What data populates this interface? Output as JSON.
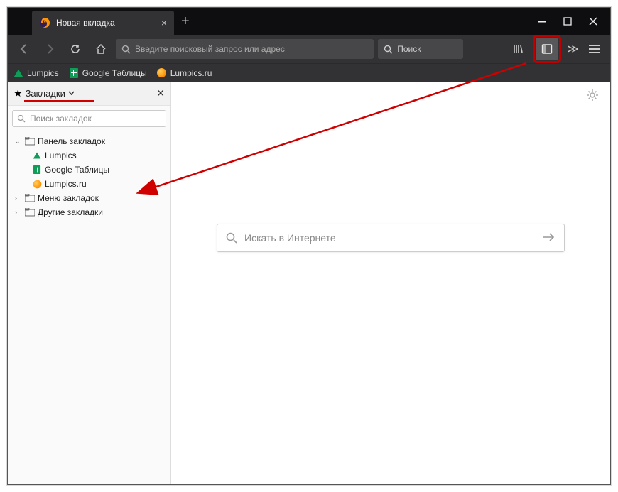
{
  "tab": {
    "title": "Новая вкладка"
  },
  "urlbar": {
    "placeholder": "Введите поисковый запрос или адрес"
  },
  "searchbar": {
    "placeholder": "Поиск"
  },
  "bookmarks_toolbar": [
    {
      "label": "Lumpics",
      "icon": "drive"
    },
    {
      "label": "Google Таблицы",
      "icon": "sheets"
    },
    {
      "label": "Lumpics.ru",
      "icon": "orange"
    }
  ],
  "sidebar": {
    "title": "Закладки",
    "search_placeholder": "Поиск закладок",
    "tree": {
      "toolbar_folder": "Панель закладок",
      "items": [
        {
          "label": "Lumpics",
          "icon": "drive"
        },
        {
          "label": "Google Таблицы",
          "icon": "sheets"
        },
        {
          "label": "Lumpics.ru",
          "icon": "orange"
        }
      ],
      "menu_folder": "Меню закладок",
      "other_folder": "Другие закладки"
    }
  },
  "newtab": {
    "search_placeholder": "Искать в Интернете"
  }
}
